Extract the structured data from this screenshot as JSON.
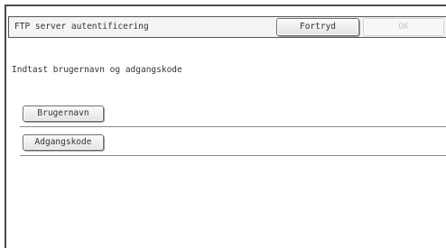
{
  "dialog": {
    "title": "FTP server autentificering",
    "cancel_label": "Fortryd",
    "ok_label": "OK",
    "ok_enabled": false
  },
  "content": {
    "instruction": "Indtast brugernavn og adgangskode",
    "fields": [
      {
        "label": "Brugernavn"
      },
      {
        "label": "Adgangskode"
      }
    ]
  }
}
